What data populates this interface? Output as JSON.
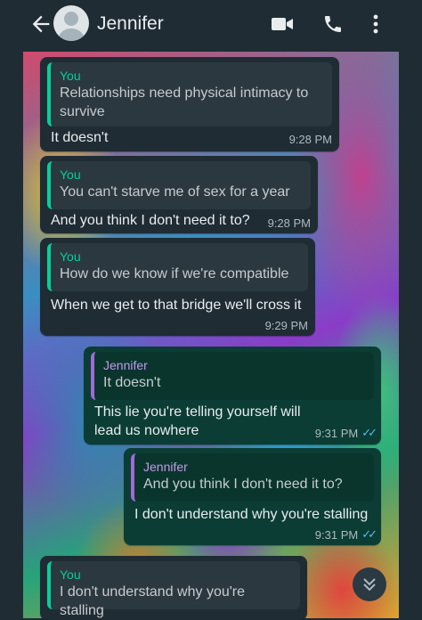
{
  "header": {
    "contact_name": "Jennifer",
    "icons": [
      "back-arrow-icon",
      "avatar-icon",
      "video-call-icon",
      "phone-icon",
      "more-vert-icon"
    ]
  },
  "messages": [
    {
      "direction": "incoming",
      "quote_author": "You",
      "quote_text": "Relationships need physical intimacy to survive",
      "text": "It doesn't",
      "time": "9:28 PM"
    },
    {
      "direction": "incoming",
      "quote_author": "You",
      "quote_text": "You can't starve me of sex for a year",
      "text": "And you think I don't need it to?",
      "time": "9:28 PM"
    },
    {
      "direction": "incoming",
      "quote_author": "You",
      "quote_text": "How do we know if we're compatible",
      "text": "When we get to that bridge we'll cross it",
      "time": "9:29 PM"
    },
    {
      "direction": "outgoing",
      "quote_author": "Jennifer",
      "quote_text": "It doesn't",
      "text": "This lie you're telling yourself will lead us nowhere",
      "time": "9:31 PM",
      "status": "read"
    },
    {
      "direction": "outgoing",
      "quote_author": "Jennifer",
      "quote_text": "And you think I don't need it to?",
      "text": "I don't understand why you're stalling",
      "time": "9:31 PM",
      "status": "read"
    },
    {
      "direction": "incoming",
      "quote_author": "You",
      "quote_text": "I don't understand why you're stalling",
      "text": "",
      "time": ""
    }
  ],
  "colors": {
    "header_bg": "#1f2c34",
    "incoming_bubble": "#1f2c34",
    "outgoing_bubble": "#0b3d34",
    "quote_you_accent": "#06cf9c",
    "quote_jennifer_accent": "#a26ad6",
    "read_ticks": "#53bdeb"
  }
}
